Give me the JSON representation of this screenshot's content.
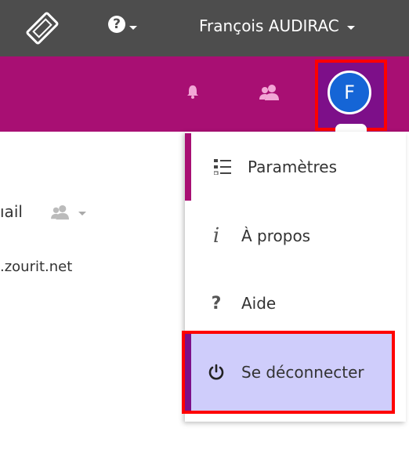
{
  "topbar": {
    "help_icon": "?",
    "user_name": "François AUDIRAC"
  },
  "appbar": {
    "avatar_initial": "F"
  },
  "dropdown": {
    "items": [
      {
        "label": "Paramètres",
        "icon": "list-icon"
      },
      {
        "label": "À propos",
        "icon": "info-icon"
      },
      {
        "label": "Aide",
        "icon": "question-icon"
      },
      {
        "label": "Se déconnecter",
        "icon": "power-icon"
      }
    ]
  },
  "background": {
    "partial_label": "ıail",
    "partial_email": ".zourit.net"
  },
  "colors": {
    "topbar": "#4d4d4d",
    "appbar": "#a80f73",
    "avatar": "#1565d6",
    "highlight_border": "#ff0000",
    "logout_bg": "#cfcdfb"
  }
}
